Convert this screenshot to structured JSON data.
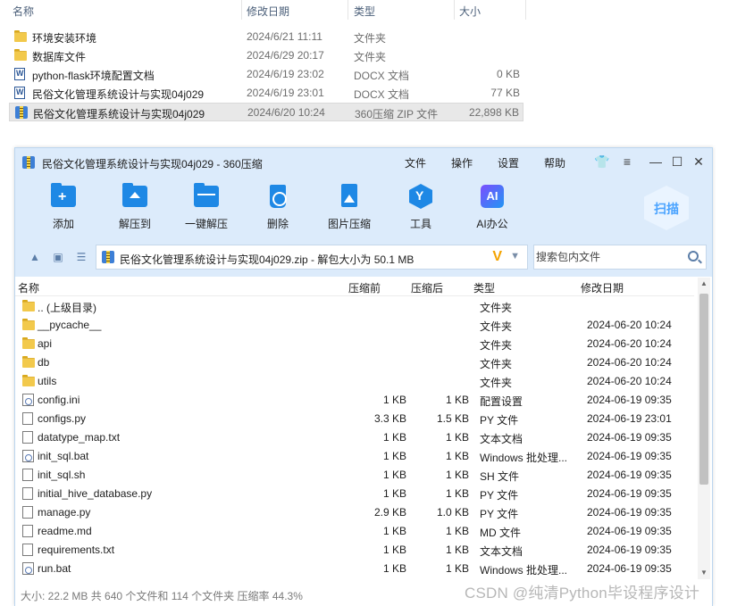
{
  "explorer": {
    "columns": {
      "name": "名称",
      "date": "修改日期",
      "type": "类型",
      "size": "大小"
    },
    "rows": [
      {
        "name": "环境安装环境",
        "date": "2024/6/21 11:11",
        "type": "文件夹",
        "size": "",
        "icon": "folder-icon"
      },
      {
        "name": "数据库文件",
        "date": "2024/6/29 20:17",
        "type": "文件夹",
        "size": "",
        "icon": "folder-icon"
      },
      {
        "name": "python-flask环境配置文档",
        "date": "2024/6/19 23:02",
        "type": "DOCX 文档",
        "size": "0 KB",
        "icon": "docx-icon"
      },
      {
        "name": "民俗文化管理系统设计与实现04j029",
        "date": "2024/6/19 23:01",
        "type": "DOCX 文档",
        "size": "77 KB",
        "icon": "docx-icon"
      },
      {
        "name": "民俗文化管理系统设计与实现04j029",
        "date": "2024/6/20 10:24",
        "type": "360压缩 ZIP 文件",
        "size": "22,898 KB",
        "icon": "zip-icon"
      }
    ]
  },
  "zip": {
    "title": "民俗文化管理系统设计与实现04j029 - 360压缩",
    "menu": [
      "文件",
      "操作",
      "设置",
      "帮助"
    ],
    "window_icons": [
      "shirt-icon",
      "menu-icon",
      "minimize-icon",
      "maximize-icon",
      "close-icon"
    ],
    "toolbar": [
      {
        "label": "添加",
        "icon": "add-icon"
      },
      {
        "label": "解压到",
        "icon": "extract-to-icon"
      },
      {
        "label": "一键解压",
        "icon": "one-click-extract-icon"
      },
      {
        "label": "删除",
        "icon": "delete-icon"
      },
      {
        "label": "图片压缩",
        "icon": "image-compress-icon"
      },
      {
        "label": "工具",
        "icon": "tools-icon"
      },
      {
        "label": "AI办公",
        "icon": "ai-office-icon"
      }
    ],
    "scan_label": "扫描",
    "path": "民俗文化管理系统设计与实现04j029.zip - 解包大小为 50.1 MB",
    "search_placeholder": "搜索包内文件",
    "columns": {
      "name": "名称",
      "before": "压缩前",
      "after": "压缩后",
      "type": "类型",
      "date": "修改日期"
    },
    "rows": [
      {
        "name": ".. (上级目录)",
        "before": "",
        "after": "",
        "type": "文件夹",
        "date": "",
        "icon": "folder-icon"
      },
      {
        "name": "__pycache__",
        "before": "",
        "after": "",
        "type": "文件夹",
        "date": "2024-06-20 10:24",
        "icon": "folder-icon"
      },
      {
        "name": "api",
        "before": "",
        "after": "",
        "type": "文件夹",
        "date": "2024-06-20 10:24",
        "icon": "folder-icon"
      },
      {
        "name": "db",
        "before": "",
        "after": "",
        "type": "文件夹",
        "date": "2024-06-20 10:24",
        "icon": "folder-icon"
      },
      {
        "name": "utils",
        "before": "",
        "after": "",
        "type": "文件夹",
        "date": "2024-06-20 10:24",
        "icon": "folder-icon"
      },
      {
        "name": "config.ini",
        "before": "1 KB",
        "after": "1 KB",
        "type": "配置设置",
        "date": "2024-06-19 09:35",
        "icon": "config-file-icon"
      },
      {
        "name": "configs.py",
        "before": "3.3 KB",
        "after": "1.5 KB",
        "type": "PY 文件",
        "date": "2024-06-19 23:01",
        "icon": "file-icon"
      },
      {
        "name": "datatype_map.txt",
        "before": "1 KB",
        "after": "1 KB",
        "type": "文本文档",
        "date": "2024-06-19 09:35",
        "icon": "file-icon"
      },
      {
        "name": "init_sql.bat",
        "before": "1 KB",
        "after": "1 KB",
        "type": "Windows 批处理...",
        "date": "2024-06-19 09:35",
        "icon": "batch-file-icon"
      },
      {
        "name": "init_sql.sh",
        "before": "1 KB",
        "after": "1 KB",
        "type": "SH 文件",
        "date": "2024-06-19 09:35",
        "icon": "file-icon"
      },
      {
        "name": "initial_hive_database.py",
        "before": "1 KB",
        "after": "1 KB",
        "type": "PY 文件",
        "date": "2024-06-19 09:35",
        "icon": "file-icon"
      },
      {
        "name": "manage.py",
        "before": "2.9 KB",
        "after": "1.0 KB",
        "type": "PY 文件",
        "date": "2024-06-19 09:35",
        "icon": "file-icon"
      },
      {
        "name": "readme.md",
        "before": "1 KB",
        "after": "1 KB",
        "type": "MD 文件",
        "date": "2024-06-19 09:35",
        "icon": "file-icon"
      },
      {
        "name": "requirements.txt",
        "before": "1 KB",
        "after": "1 KB",
        "type": "文本文档",
        "date": "2024-06-19 09:35",
        "icon": "file-icon"
      },
      {
        "name": "run.bat",
        "before": "1 KB",
        "after": "1 KB",
        "type": "Windows 批处理...",
        "date": "2024-06-19 09:35",
        "icon": "batch-file-icon"
      }
    ],
    "status": "大小: 22.2 MB 共 640 个文件和 114 个文件夹 压缩率 44.3%"
  },
  "watermark": "CSDN @纯清Python毕设程序设计",
  "colors": {
    "titlebar_bg": "#dcebfb",
    "accent": "#1e88e5",
    "selected_row": "#e8e8e8"
  }
}
